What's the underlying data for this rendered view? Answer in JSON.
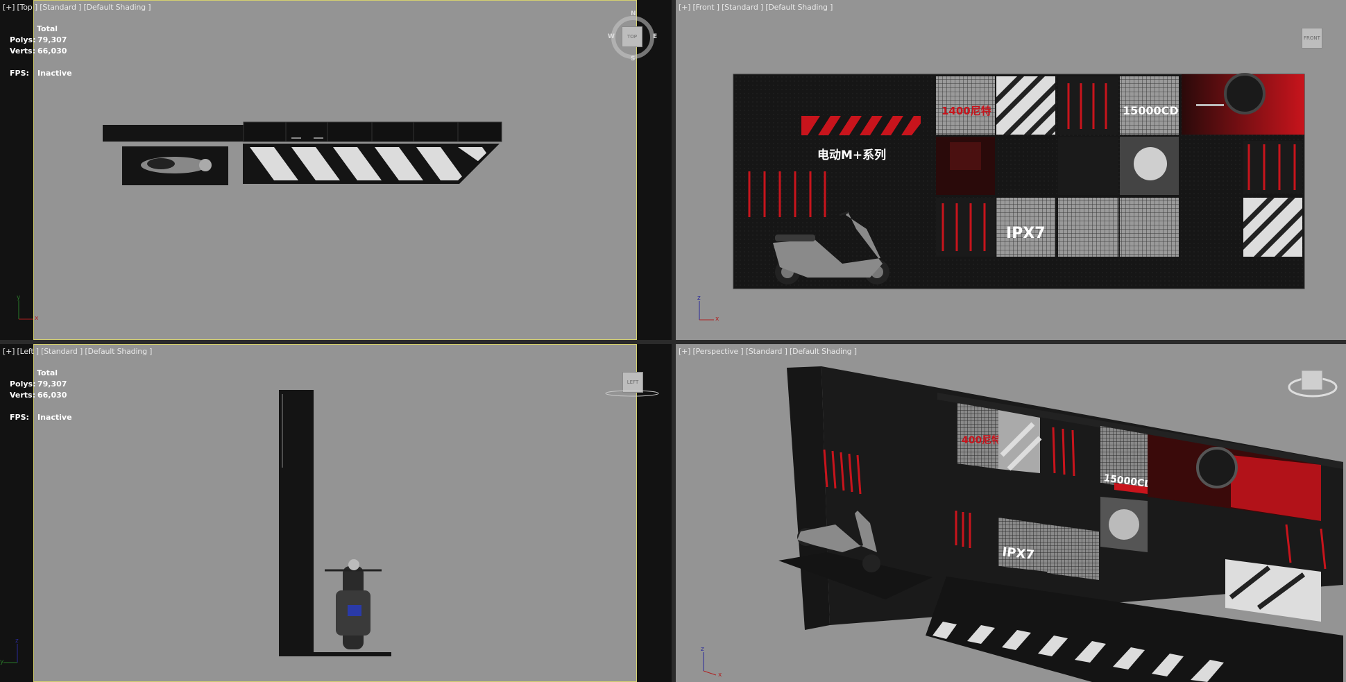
{
  "viewports": {
    "top": {
      "label": "[+] [Top ] [Standard ] [Default Shading ]",
      "cube": "TOP",
      "compass": {
        "n": "N",
        "s": "S",
        "e": "E",
        "w": "W"
      },
      "axes": {
        "a": "y",
        "b": "x"
      }
    },
    "front": {
      "label": "[+] [Front ] [Standard ] [Default Shading ]",
      "cube": "FRONT",
      "axes": {
        "a": "z",
        "b": "x"
      }
    },
    "left": {
      "label": "[+] [Left ] [Standard ] [Default Shading ]",
      "cube": "LEFT",
      "axes": {
        "a": "z",
        "b": "y"
      }
    },
    "perspective": {
      "label": "[+] [Perspective ] [Standard ] [Default Shading ]",
      "cube": "FRONT",
      "axes": {
        "a": "z",
        "b": "x"
      }
    }
  },
  "stats": {
    "total_label": "Total",
    "polys_label": "Polys:",
    "polys_value": "79,307",
    "verts_label": "Verts:",
    "verts_value": "66,030",
    "fps_label": "FPS:",
    "fps_value": "Inactive"
  },
  "scene": {
    "front_text_1": "1400尼特",
    "front_text_2": "15000CD",
    "front_title": "电动M+系列",
    "front_text_3": "IPX7",
    "persp_text_1": "400尼特",
    "persp_text_2": "15000CD",
    "persp_text_3": "IPX7"
  },
  "colors": {
    "viewport_bg": "#949494",
    "panel_dark": "#121212",
    "accent_red": "#c8141c",
    "selection": "#d4d070"
  }
}
